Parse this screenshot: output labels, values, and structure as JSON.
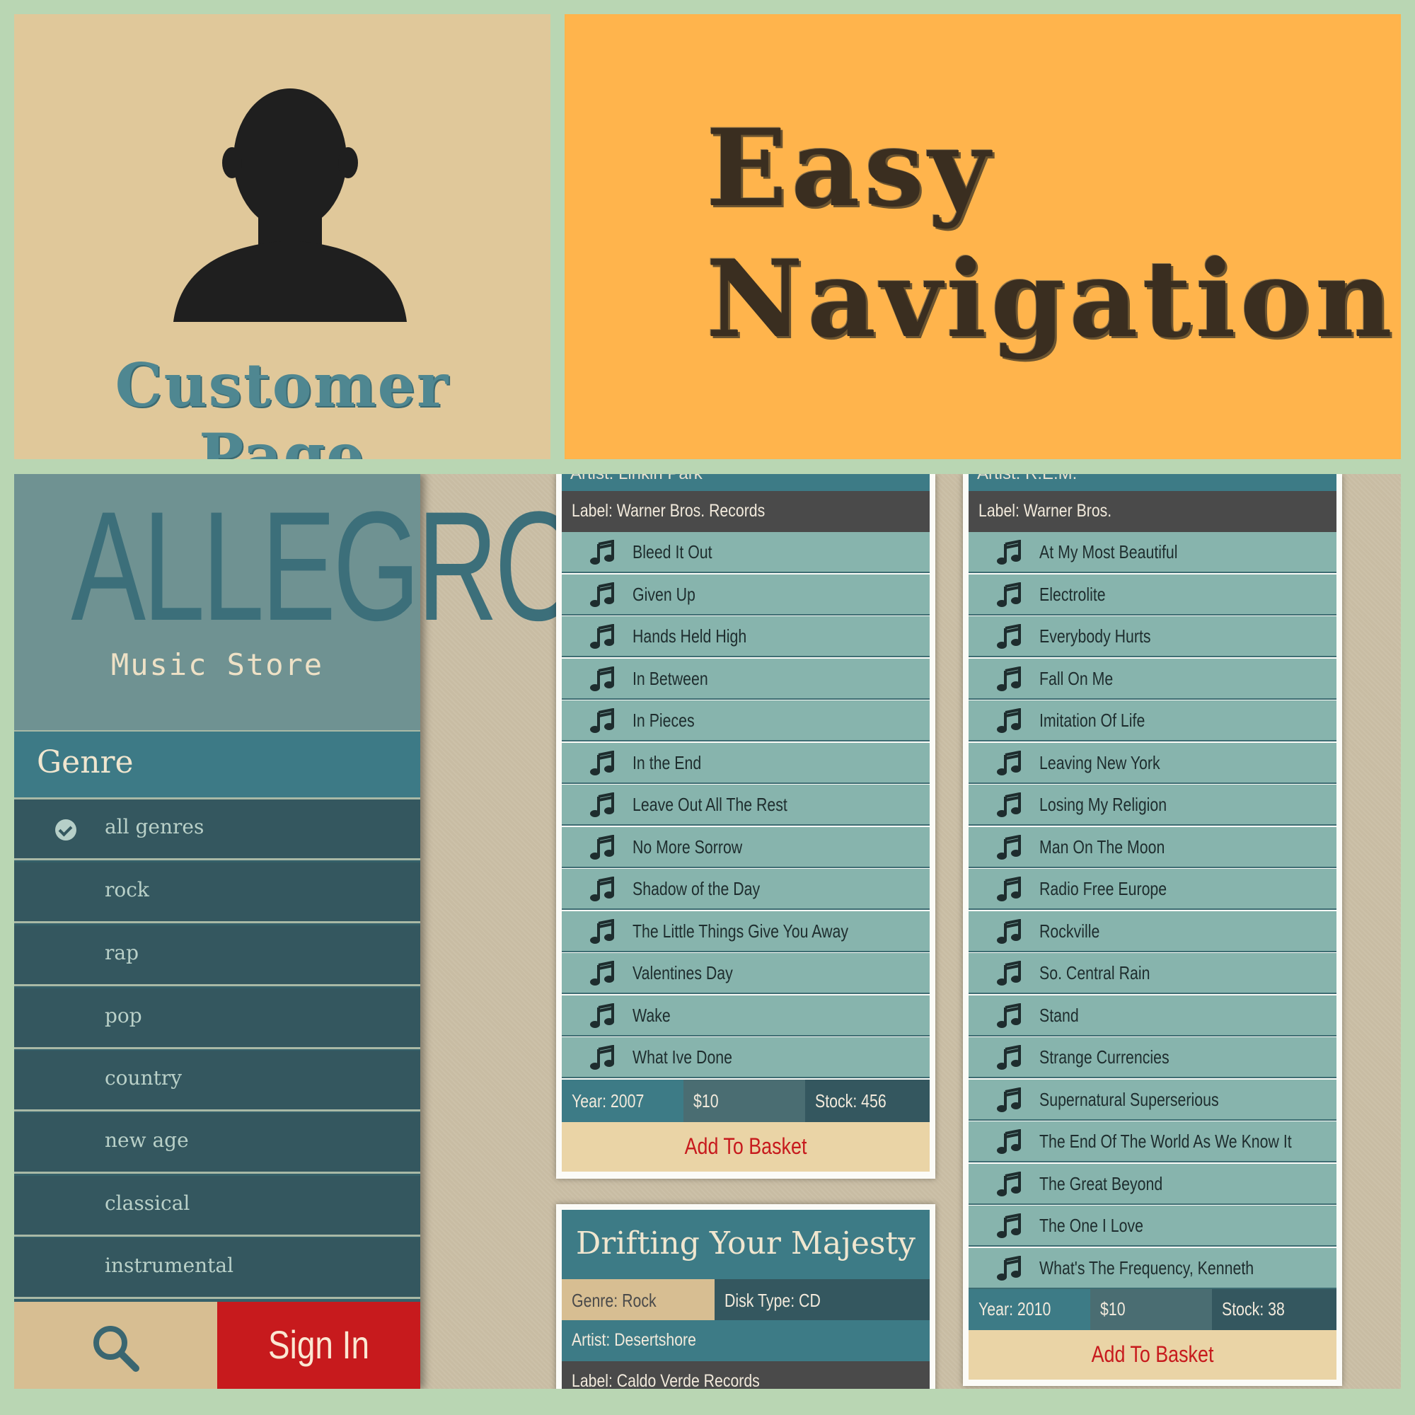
{
  "customer_tile": {
    "caption": "Customer Page",
    "icon": "user-silhouette-icon"
  },
  "navigation_tile": {
    "line1": "Easy",
    "line2": "Navigation"
  },
  "colors": {
    "accent_red": "#c71a1d",
    "teal": "#3d7b86",
    "sidebar": "#34575f",
    "track_row": "#87b4ad"
  },
  "app": {
    "logo": {
      "brand": "ALLEGRO",
      "subtitle": "Music Store"
    },
    "genre_header": "Genre",
    "genres": [
      {
        "label": "all genres",
        "selected": true
      },
      {
        "label": "rock",
        "selected": false
      },
      {
        "label": "rap",
        "selected": false
      },
      {
        "label": "pop",
        "selected": false
      },
      {
        "label": "country",
        "selected": false
      },
      {
        "label": "new age",
        "selected": false
      },
      {
        "label": "classical",
        "selected": false
      },
      {
        "label": "instrumental",
        "selected": false
      }
    ],
    "search_icon": "search-icon",
    "sign_in": "Sign In",
    "albums": [
      {
        "artist": "Artist: Linkin Park",
        "label": "Label: Warner Bros. Records",
        "tracks": [
          "Bleed It Out",
          "Given Up",
          "Hands Held High",
          "In Between",
          "In Pieces",
          "In the End",
          "Leave Out All The Rest",
          "No More Sorrow",
          "Shadow of the Day",
          "The Little Things Give You Away",
          "Valentines Day",
          "Wake",
          "What Ive Done"
        ],
        "year": "Year: 2007",
        "price": "$10",
        "stock": "Stock: 456",
        "basket": "Add To Basket"
      },
      {
        "artist": "Artist: R.E.M.",
        "label": "Label: Warner Bros.",
        "tracks": [
          "At My Most Beautiful",
          "Electrolite",
          "Everybody Hurts",
          "Fall On Me",
          "Imitation Of Life",
          "Leaving New York",
          "Losing My Religion",
          "Man On The Moon",
          "Radio Free Europe",
          "Rockville",
          "So. Central Rain",
          "Stand",
          "Strange Currencies",
          "Supernatural Superserious",
          "The End Of The World As We Know It",
          "The Great Beyond",
          "The One I Love",
          "What's The Frequency, Kenneth"
        ],
        "year": "Year: 2010",
        "price": "$10",
        "stock": "Stock: 38",
        "basket": "Add To Basket"
      },
      {
        "title": "Drifting Your Majesty",
        "genre": "Genre: Rock",
        "disk_type": "Disk Type: CD",
        "artist": "Artist: Desertshore",
        "label": "Label: Caldo Verde Records"
      }
    ]
  }
}
